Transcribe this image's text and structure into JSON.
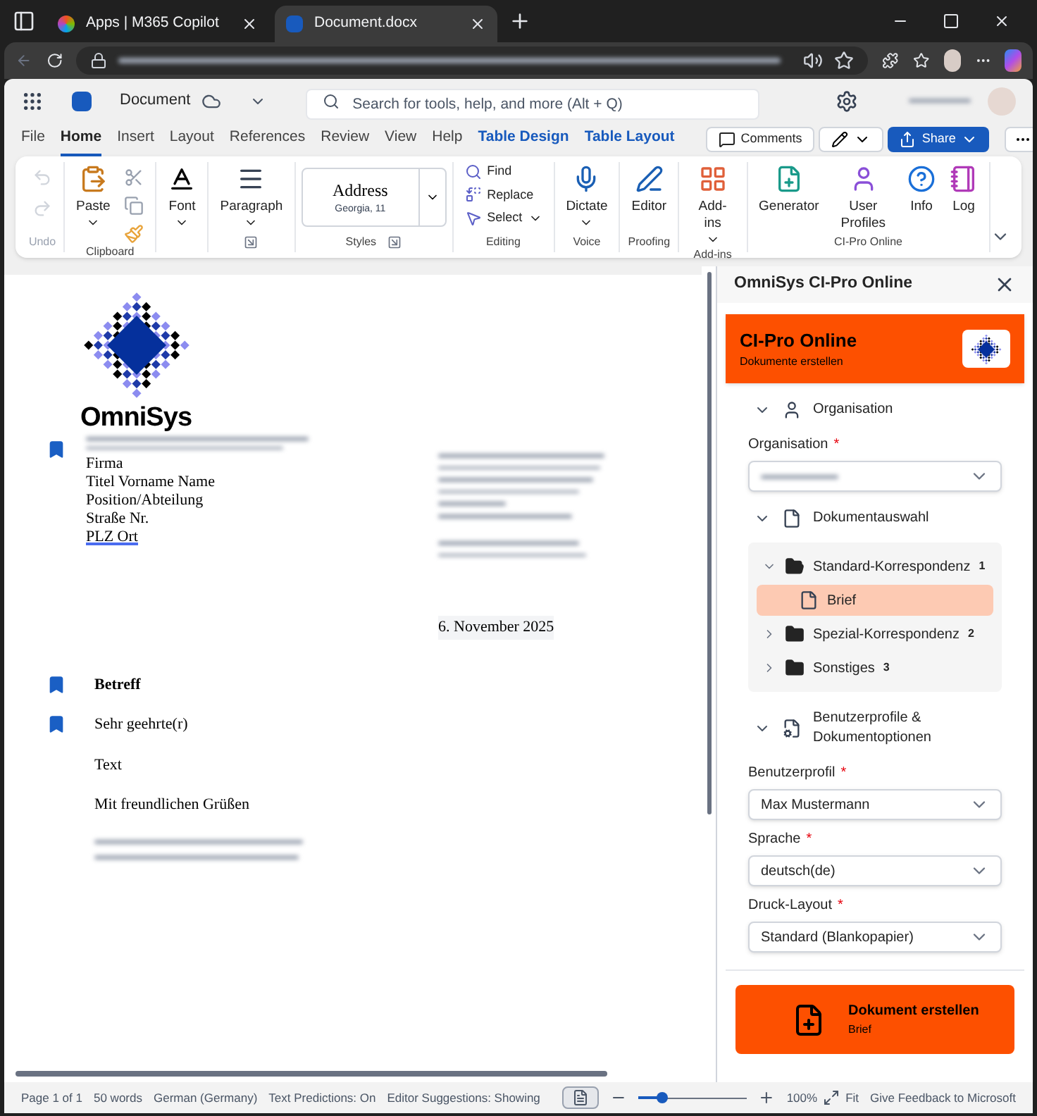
{
  "browser": {
    "tabs": [
      {
        "label": "Apps | M365 Copilot",
        "selected": false
      },
      {
        "label": "Document.docx",
        "selected": true
      }
    ]
  },
  "app_header": {
    "document_name": "Document",
    "search": {
      "placeholder": "Search for tools, help, and more (Alt + Q)"
    }
  },
  "ribbon_tabs": [
    {
      "label": "File",
      "selected": false,
      "kind": "standard"
    },
    {
      "label": "Home",
      "selected": true,
      "kind": "standard"
    },
    {
      "label": "Insert",
      "selected": false,
      "kind": "standard"
    },
    {
      "label": "Layout",
      "selected": false,
      "kind": "standard"
    },
    {
      "label": "References",
      "selected": false,
      "kind": "standard"
    },
    {
      "label": "Review",
      "selected": false,
      "kind": "standard"
    },
    {
      "label": "View",
      "selected": false,
      "kind": "standard"
    },
    {
      "label": "Help",
      "selected": false,
      "kind": "standard"
    },
    {
      "label": "Table Design",
      "selected": false,
      "kind": "contextual"
    },
    {
      "label": "Table Layout",
      "selected": false,
      "kind": "contextual"
    }
  ],
  "header_buttons": {
    "comments": "Comments",
    "share": "Share"
  },
  "ribbon": {
    "groups": [
      {
        "label": "Undo",
        "disabled": true
      },
      {
        "label": "Clipboard",
        "items": [
          "Paste"
        ]
      },
      {
        "items": [
          "Font"
        ]
      },
      {
        "items": [
          "Paragraph"
        ]
      },
      {
        "label": "Styles",
        "style": {
          "name": "Address",
          "font": "Georgia, 11"
        }
      },
      {
        "label": "Editing",
        "items": [
          "Find",
          "Replace",
          "Select"
        ]
      },
      {
        "label": "Voice",
        "items": [
          "Dictate"
        ]
      },
      {
        "label": "Proofing",
        "items": [
          "Editor"
        ]
      },
      {
        "label": "Add-ins",
        "items": [
          "Add-ins"
        ]
      },
      {
        "label": "CI-Pro Online",
        "items": [
          "Generator",
          "User Profiles",
          "Info",
          "Log"
        ]
      }
    ]
  },
  "document": {
    "logo_text": "OmniSys",
    "recipient_lines": [
      {
        "text": "Firma",
        "flagged": false
      },
      {
        "text": "Titel Vorname Name",
        "flagged": false
      },
      {
        "text": "Position/Abteilung",
        "flagged": false
      },
      {
        "text": "Straße Nr.",
        "flagged": false
      },
      {
        "text": "PLZ Ort",
        "flagged": true
      }
    ],
    "date": "6. November 2025",
    "subject": "Betreff",
    "salutation": "Sehr geehrte(r)",
    "body": "Text",
    "closing": "Mit freundlichen Grüßen"
  },
  "task_pane": {
    "title": "OmniSys CI-Pro Online",
    "banner": {
      "title": "CI-Pro Online",
      "subtitle": "Dokumente erstellen"
    },
    "sections": [
      {
        "kind": "organisation",
        "title": "Organisation",
        "expanded": true,
        "fields": [
          {
            "label": "Organisation",
            "required_mark": "*",
            "value_redacted": true
          }
        ]
      },
      {
        "kind": "tree",
        "title": "Dokumentauswahl",
        "expanded": true,
        "tree": [
          {
            "label": "Standard-Korrespondenz",
            "count": "1",
            "expanded": true,
            "selected": false,
            "children": [
              {
                "label": "Brief",
                "selected": true
              }
            ]
          },
          {
            "label": "Spezial-Korrespondenz",
            "count": "2",
            "expanded": false,
            "selected": false
          },
          {
            "label": "Sonstiges",
            "count": "3",
            "expanded": false,
            "selected": false
          }
        ]
      },
      {
        "kind": "options",
        "title": "Benutzerprofile & Dokumentoptionen",
        "expanded": true,
        "fields": [
          {
            "label": "Benutzerprofil",
            "required_mark": "*",
            "value": "Max Mustermann"
          },
          {
            "label": "Sprache",
            "required_mark": "*",
            "value": "deutsch(de)"
          },
          {
            "label": "Druck-Layout",
            "required_mark": "*",
            "value": "Standard (Blankopapier)"
          }
        ]
      }
    ],
    "create_button": {
      "label": "Dokument erstellen",
      "sublabel": "Brief"
    }
  },
  "status_bar": {
    "items": [
      "Page 1 of 1",
      "50 words",
      "German (Germany)",
      "Text Predictions: On",
      "Editor Suggestions: Showing"
    ],
    "zoom": {
      "level": 0.22,
      "reading": "100%"
    },
    "fit": "Fit",
    "feedback": "Give Feedback to Microsoft"
  }
}
